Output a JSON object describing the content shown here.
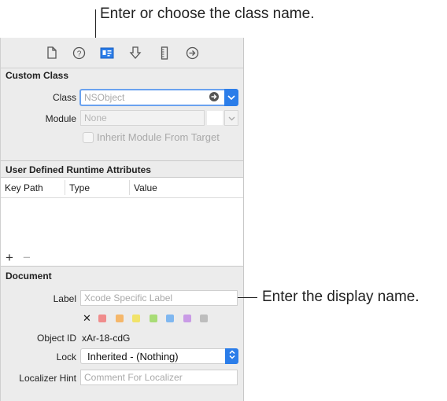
{
  "callouts": {
    "class_name": "Enter or choose the class name.",
    "display_name": "Enter the display name."
  },
  "toolbar": {
    "icons": [
      "file-icon",
      "help-icon",
      "identity-icon",
      "attributes-icon",
      "size-icon",
      "connections-icon"
    ]
  },
  "custom_class": {
    "title": "Custom Class",
    "class_label": "Class",
    "class_placeholder": "NSObject",
    "module_label": "Module",
    "module_placeholder": "None",
    "inherit_label": "Inherit Module From Target"
  },
  "runtime_attributes": {
    "title": "User Defined Runtime Attributes",
    "columns": [
      "Key Path",
      "Type",
      "Value"
    ],
    "add_label": "+",
    "remove_label": "−"
  },
  "document": {
    "title": "Document",
    "label_label": "Label",
    "label_placeholder": "Xcode Specific Label",
    "clear_label": "✕",
    "swatch_colors": [
      "#f08c8c",
      "#f5b76a",
      "#f1e36a",
      "#a8dc76",
      "#7fb7f0",
      "#c99be6",
      "#bdbdbd"
    ],
    "object_id_label": "Object ID",
    "object_id_value": "xAr-18-cdG",
    "lock_label": "Lock",
    "lock_value": "Inherited - (Nothing)",
    "localizer_label": "Localizer Hint",
    "localizer_placeholder": "Comment For Localizer"
  },
  "colors": {
    "accent": "#2b7de9",
    "panel": "#ececec"
  }
}
